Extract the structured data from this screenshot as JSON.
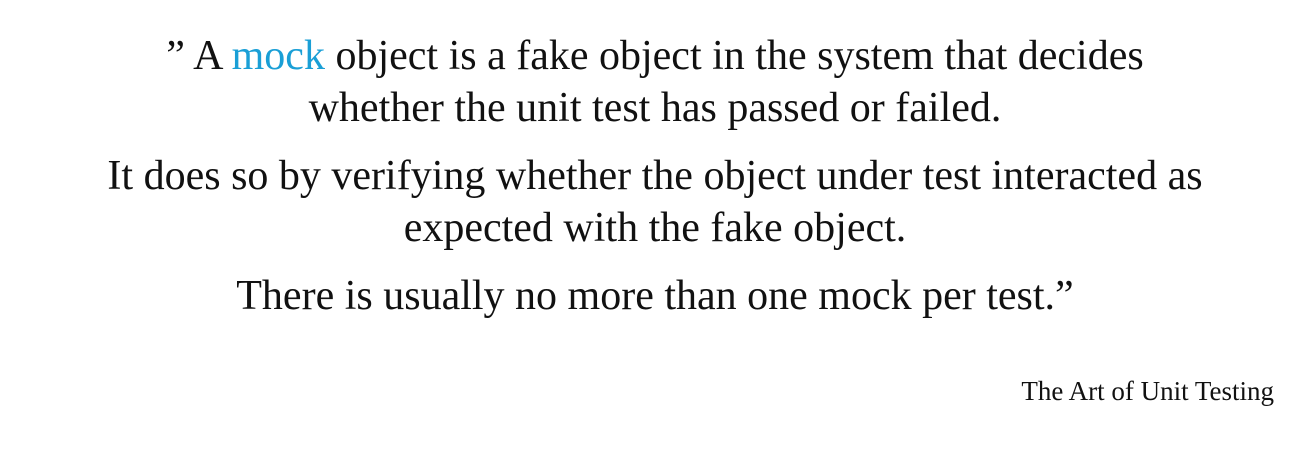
{
  "quote": {
    "paragraph1": {
      "open_mark": "” A ",
      "highlight": "mock",
      "rest_line1": " object is a fake object in the system that decides",
      "line2": "whether the unit test has passed or failed."
    },
    "paragraph2": {
      "line1": "It does so by verifying whether the object under test interacted as",
      "line2": "expected with the fake object."
    },
    "paragraph3": {
      "line1": "There is usually no more than one mock per test.”"
    }
  },
  "source": "The Art of Unit Testing",
  "colors": {
    "highlight": "#1a9fd6",
    "text": "#111111",
    "background": "#ffffff"
  }
}
